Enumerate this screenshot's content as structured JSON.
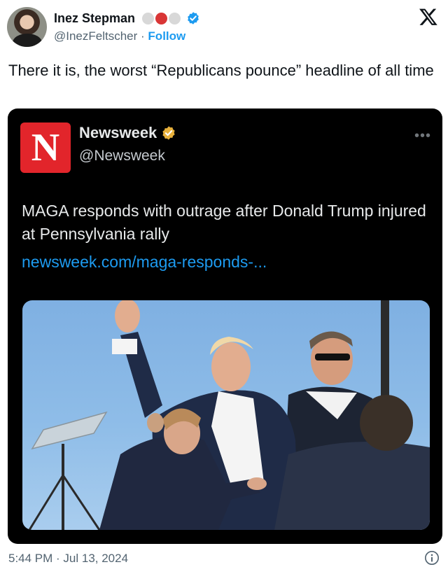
{
  "header": {
    "display_name": "Inez Stepman",
    "handle": "@InezFeltscher",
    "separator": " · ",
    "follow_label": "Follow",
    "badge_colors": [
      "#d8d8d8",
      "#d93636",
      "#d8d8d8"
    ],
    "verified_color": "#1d9bf0"
  },
  "tweet": {
    "text": "There it is, the worst “Republicans pounce” headline of all time",
    "timestamp": "5:44 PM · Jul 13, 2024"
  },
  "embedded": {
    "logo_letter": "N",
    "logo_color": "#e2252b",
    "display_name": "Newsweek",
    "handle": "@Newsweek",
    "verified_color": "#e8b13c",
    "more_label": "•••",
    "text": "MAGA responds with outrage after Donald Trump injured at Pennsylvania rally",
    "link": "newsweek.com/maga-responds-..."
  },
  "icons": {
    "x_logo": "x-logo-icon",
    "info": "info-icon",
    "verified": "verified-badge-icon"
  }
}
